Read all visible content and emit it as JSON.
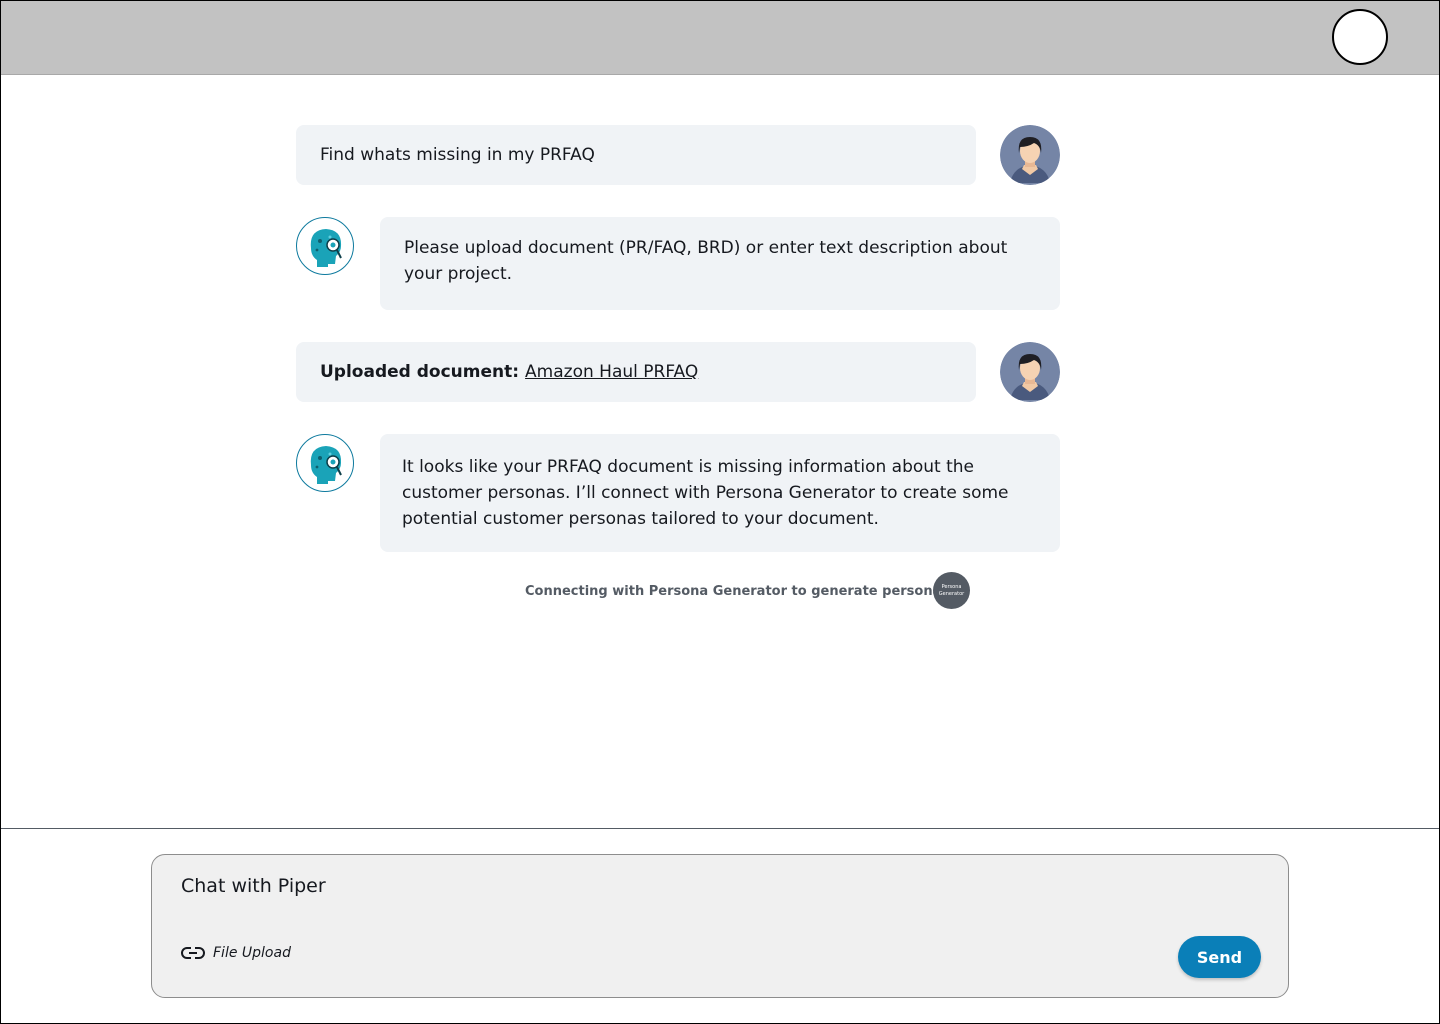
{
  "header": {
    "profile_button_icon": "profile-circle-icon"
  },
  "conversation": {
    "msg1_text": "Find whats missing in my PRFAQ",
    "msg2_text": "Please upload document (PR/FAQ, BRD) or enter text description about your project.",
    "msg3_label": "Uploaded document:",
    "msg3_link": "Amazon Haul PRFAQ",
    "msg4_text": "It looks like your PRFAQ document is missing information about the customer personas. I’ll connect with Persona Generator to create some potential customer personas tailored to your document.",
    "status_text": "Connecting with Persona Generator to generate personas",
    "badge_line1": "Persona",
    "badge_line2": "Generator"
  },
  "composer": {
    "placeholder": "Chat with Piper",
    "file_upload_label": "File Upload",
    "send_label": "Send"
  },
  "colors": {
    "topbar": "#c2c2c2",
    "bubble": "#f0f3f6",
    "accent": "#0a7fb8",
    "bot_teal": "#1aa3b8"
  }
}
